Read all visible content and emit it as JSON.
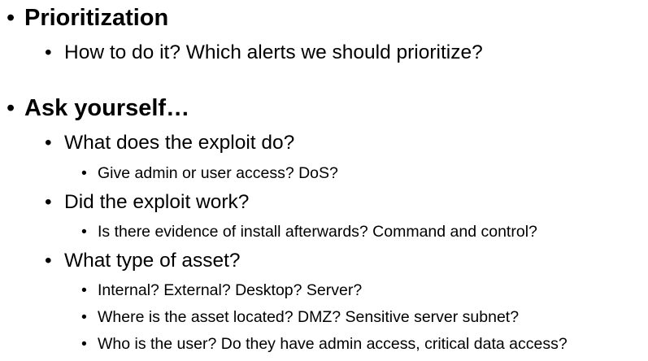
{
  "bullet_glyph": "•",
  "sections": [
    {
      "heading": "Prioritization",
      "items": [
        {
          "text": "How to do it? Which alerts we should prioritize?",
          "subitems": []
        }
      ]
    },
    {
      "heading": "Ask yourself…",
      "items": [
        {
          "text": "What does the exploit do?",
          "subitems": [
            "Give admin or user access? DoS?"
          ]
        },
        {
          "text": "Did the exploit work?",
          "subitems": [
            "Is there evidence of install afterwards? Command and control?"
          ]
        },
        {
          "text": "What type of asset?",
          "subitems": [
            "Internal? External? Desktop? Server?",
            "Where is the asset located? DMZ? Sensitive server subnet?",
            "Who is the user? Do they have admin access, critical data access?"
          ]
        }
      ]
    }
  ]
}
